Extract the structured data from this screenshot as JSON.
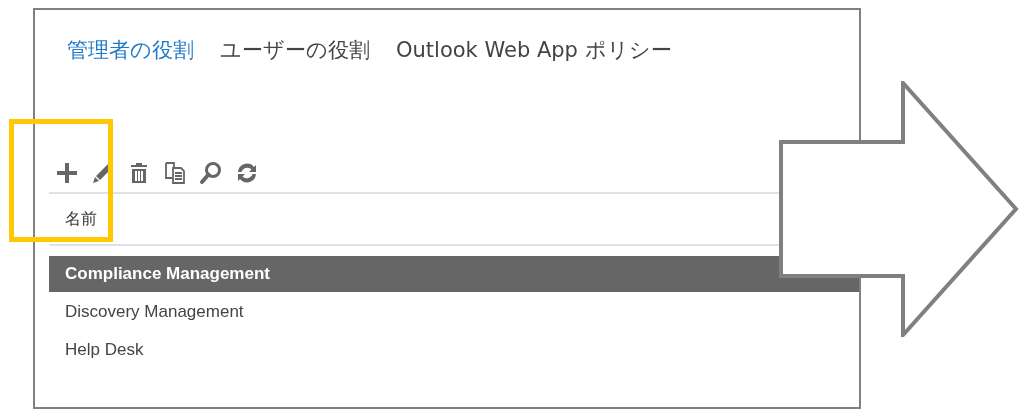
{
  "tabs": [
    {
      "label": "管理者の役割",
      "selected": true
    },
    {
      "label": "ユーザーの役割",
      "selected": false
    },
    {
      "label": "Outlook Web App ポリシー",
      "selected": false
    }
  ],
  "toolbar": [
    {
      "kind": "add"
    },
    {
      "kind": "edit"
    },
    {
      "kind": "delete"
    },
    {
      "kind": "copy"
    },
    {
      "kind": "search"
    },
    {
      "kind": "refresh"
    }
  ],
  "table": {
    "columns": [
      "名前"
    ],
    "rows": [
      {
        "name": "Compliance Management",
        "selected": true
      },
      {
        "name": "Discovery Management",
        "selected": false
      },
      {
        "name": "Help Desk",
        "selected": false
      }
    ]
  }
}
